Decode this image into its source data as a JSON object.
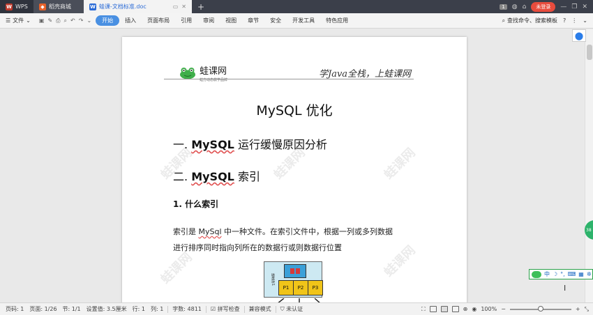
{
  "titlebar": {
    "tabs": [
      {
        "label": "WPS",
        "icon": "wps-logo-icon"
      },
      {
        "label": "稻壳商城",
        "icon": "daoke-store-icon"
      },
      {
        "label": "蛙课-文档标准.doc",
        "icon": "word-doc-icon"
      }
    ],
    "page_badge": "1",
    "login_label": "未登录"
  },
  "ribbon": {
    "file_label": "文件",
    "tabs": [
      "开始",
      "插入",
      "页面布局",
      "引用",
      "审阅",
      "视图",
      "章节",
      "安全",
      "开发工具",
      "特色应用"
    ],
    "search_label": "查找命令、搜索模板",
    "help_label": "?"
  },
  "document": {
    "logo_text": "蛙课网",
    "logo_subtext": "蛙方动态教学品牌",
    "slogan": "学Java全栈，上蛙课网",
    "title": "MySQL 优化",
    "heading1_num": "一.",
    "heading1_bold": "MySQL",
    "heading1_rest": " 运行缓慢原因分析",
    "heading2_num": "二.",
    "heading2_bold": "MySQL",
    "heading2_rest": " 索引",
    "subheading": "1. 什么索引",
    "para_line1_pre": "索引是 ",
    "para_line1_mark": "MySql",
    "para_line1_post": " 中一种文件。在索引文件中，根据一列或多列数据",
    "para_line2": "进行排序同时指向列所在的数据行或则数据行位置",
    "watermark": "蛙课网",
    "diagram": {
      "side_label": "磁盘块1",
      "leaves": [
        "P1",
        "P2",
        "P3"
      ]
    }
  },
  "ime": {
    "label": "中"
  },
  "green_badge": "38",
  "statusbar": {
    "page_code": "页码: 1",
    "page_total": "页面: 1/26",
    "section": "节: 1/1",
    "position": "设置值: 3.5厘米",
    "row": "行: 1",
    "col": "列: 1",
    "word_count": "字数: 4811",
    "spell_check": "拼写检查",
    "compat_mode": "兼容模式",
    "cert": "未认证",
    "zoom": "100%",
    "zoom_level": 0.5
  },
  "colors": {
    "accent": "#4a90e2",
    "login": "#e84c3d",
    "titlebar": "#3b3f4a"
  }
}
